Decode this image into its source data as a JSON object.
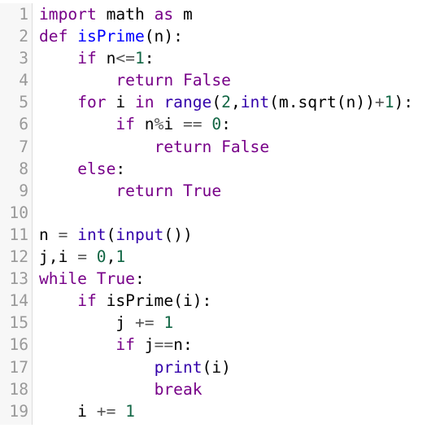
{
  "colors": {
    "keyword": "#770088",
    "number": "#116644",
    "builtin": "#3300aa",
    "definition": "#0000ff",
    "plain": "#000000",
    "operator": "#555555",
    "line_number": "#999999",
    "gutter_bg": "#f7f7f7"
  },
  "lines": [
    {
      "num": "1",
      "tokens": [
        {
          "t": "kw",
          "v": "import"
        },
        {
          "t": "plain",
          "v": " math "
        },
        {
          "t": "kw",
          "v": "as"
        },
        {
          "t": "plain",
          "v": " m"
        }
      ]
    },
    {
      "num": "2",
      "tokens": [
        {
          "t": "kw",
          "v": "def"
        },
        {
          "t": "plain",
          "v": " "
        },
        {
          "t": "def",
          "v": "isPrime"
        },
        {
          "t": "plain",
          "v": "(n):"
        }
      ]
    },
    {
      "num": "3",
      "tokens": [
        {
          "t": "plain",
          "v": "    "
        },
        {
          "t": "kw",
          "v": "if"
        },
        {
          "t": "plain",
          "v": " n"
        },
        {
          "t": "op",
          "v": "<="
        },
        {
          "t": "num",
          "v": "1"
        },
        {
          "t": "plain",
          "v": ":"
        }
      ]
    },
    {
      "num": "4",
      "tokens": [
        {
          "t": "plain",
          "v": "        "
        },
        {
          "t": "kw",
          "v": "return"
        },
        {
          "t": "plain",
          "v": " "
        },
        {
          "t": "kw",
          "v": "False"
        }
      ]
    },
    {
      "num": "5",
      "tokens": [
        {
          "t": "plain",
          "v": "    "
        },
        {
          "t": "kw",
          "v": "for"
        },
        {
          "t": "plain",
          "v": " i "
        },
        {
          "t": "kw",
          "v": "in"
        },
        {
          "t": "plain",
          "v": " "
        },
        {
          "t": "builtin",
          "v": "range"
        },
        {
          "t": "plain",
          "v": "("
        },
        {
          "t": "num",
          "v": "2"
        },
        {
          "t": "plain",
          "v": ","
        },
        {
          "t": "builtin",
          "v": "int"
        },
        {
          "t": "plain",
          "v": "(m.sqrt(n))"
        },
        {
          "t": "op",
          "v": "+"
        },
        {
          "t": "num",
          "v": "1"
        },
        {
          "t": "plain",
          "v": "):"
        }
      ]
    },
    {
      "num": "6",
      "tokens": [
        {
          "t": "plain",
          "v": "        "
        },
        {
          "t": "kw",
          "v": "if"
        },
        {
          "t": "plain",
          "v": " n"
        },
        {
          "t": "op",
          "v": "%"
        },
        {
          "t": "plain",
          "v": "i "
        },
        {
          "t": "op",
          "v": "=="
        },
        {
          "t": "plain",
          "v": " "
        },
        {
          "t": "num",
          "v": "0"
        },
        {
          "t": "plain",
          "v": ":"
        }
      ]
    },
    {
      "num": "7",
      "tokens": [
        {
          "t": "plain",
          "v": "            "
        },
        {
          "t": "kw",
          "v": "return"
        },
        {
          "t": "plain",
          "v": " "
        },
        {
          "t": "kw",
          "v": "False"
        }
      ]
    },
    {
      "num": "8",
      "tokens": [
        {
          "t": "plain",
          "v": "    "
        },
        {
          "t": "kw",
          "v": "else"
        },
        {
          "t": "plain",
          "v": ":"
        }
      ]
    },
    {
      "num": "9",
      "tokens": [
        {
          "t": "plain",
          "v": "        "
        },
        {
          "t": "kw",
          "v": "return"
        },
        {
          "t": "plain",
          "v": " "
        },
        {
          "t": "kw",
          "v": "True"
        }
      ]
    },
    {
      "num": "10",
      "tokens": []
    },
    {
      "num": "11",
      "tokens": [
        {
          "t": "plain",
          "v": "n "
        },
        {
          "t": "op",
          "v": "="
        },
        {
          "t": "plain",
          "v": " "
        },
        {
          "t": "builtin",
          "v": "int"
        },
        {
          "t": "plain",
          "v": "("
        },
        {
          "t": "builtin",
          "v": "input"
        },
        {
          "t": "plain",
          "v": "())"
        }
      ]
    },
    {
      "num": "12",
      "tokens": [
        {
          "t": "plain",
          "v": "j,i "
        },
        {
          "t": "op",
          "v": "="
        },
        {
          "t": "plain",
          "v": " "
        },
        {
          "t": "num",
          "v": "0"
        },
        {
          "t": "plain",
          "v": ","
        },
        {
          "t": "num",
          "v": "1"
        }
      ]
    },
    {
      "num": "13",
      "tokens": [
        {
          "t": "kw",
          "v": "while"
        },
        {
          "t": "plain",
          "v": " "
        },
        {
          "t": "kw",
          "v": "True"
        },
        {
          "t": "plain",
          "v": ":"
        }
      ]
    },
    {
      "num": "14",
      "tokens": [
        {
          "t": "plain",
          "v": "    "
        },
        {
          "t": "kw",
          "v": "if"
        },
        {
          "t": "plain",
          "v": " isPrime(i):"
        }
      ]
    },
    {
      "num": "15",
      "tokens": [
        {
          "t": "plain",
          "v": "        j "
        },
        {
          "t": "op",
          "v": "+="
        },
        {
          "t": "plain",
          "v": " "
        },
        {
          "t": "num",
          "v": "1"
        }
      ]
    },
    {
      "num": "16",
      "tokens": [
        {
          "t": "plain",
          "v": "        "
        },
        {
          "t": "kw",
          "v": "if"
        },
        {
          "t": "plain",
          "v": " j"
        },
        {
          "t": "op",
          "v": "=="
        },
        {
          "t": "plain",
          "v": "n:"
        }
      ]
    },
    {
      "num": "17",
      "tokens": [
        {
          "t": "plain",
          "v": "            "
        },
        {
          "t": "builtin",
          "v": "print"
        },
        {
          "t": "plain",
          "v": "(i)"
        }
      ]
    },
    {
      "num": "18",
      "tokens": [
        {
          "t": "plain",
          "v": "            "
        },
        {
          "t": "kw",
          "v": "break"
        }
      ]
    },
    {
      "num": "19",
      "tokens": [
        {
          "t": "plain",
          "v": "    i "
        },
        {
          "t": "op",
          "v": "+="
        },
        {
          "t": "plain",
          "v": " "
        },
        {
          "t": "num",
          "v": "1"
        }
      ]
    }
  ]
}
